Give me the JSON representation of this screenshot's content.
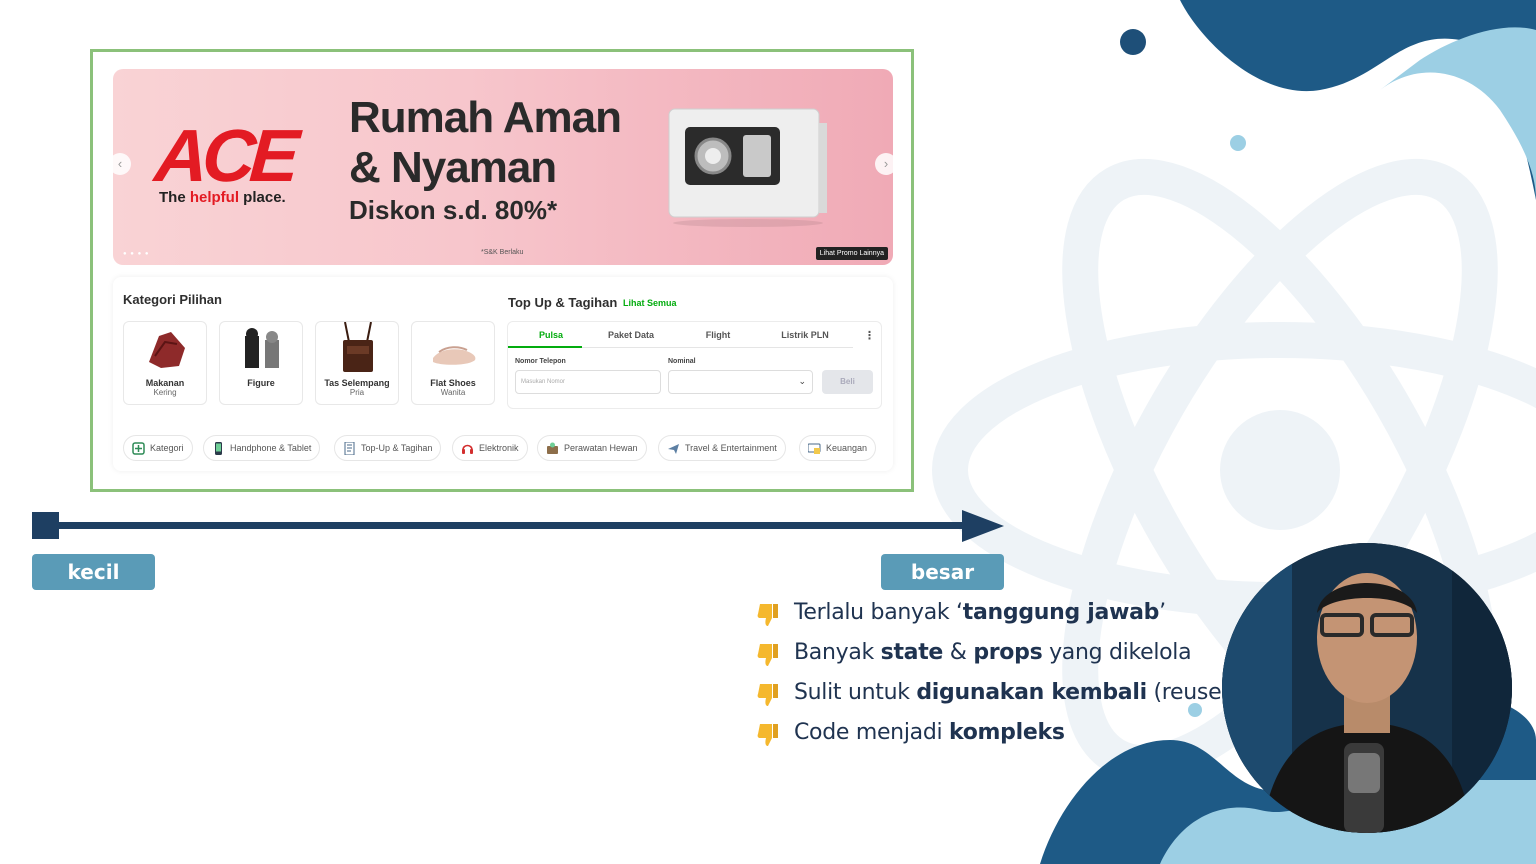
{
  "banner": {
    "brand": "ACE",
    "tagline_pre": "The ",
    "tagline_accent": "helpful",
    "tagline_post": " place.",
    "title_line1": "Rumah Aman",
    "title_line2": "& Nyaman",
    "subtitle": "Diskon s.d. 80%*",
    "note": "*S&K Berlaku",
    "promo_button": "Lihat Promo Lainnya",
    "prev_arrow": "‹",
    "next_arrow": "›"
  },
  "kategori": {
    "title": "Kategori Pilihan",
    "cards": [
      {
        "name": "Makanan",
        "sub": "Kering",
        "icon": "dried-food-icon"
      },
      {
        "name": "Figure",
        "sub": "",
        "icon": "figure-toy-icon"
      },
      {
        "name": "Tas Selempang",
        "sub": "Pria",
        "icon": "sling-bag-icon"
      },
      {
        "name": "Flat Shoes",
        "sub": "Wanita",
        "icon": "flat-shoe-icon"
      }
    ]
  },
  "topup": {
    "title": "Top Up & Tagihan",
    "link": "Lihat Semua",
    "tabs": [
      "Pulsa",
      "Paket Data",
      "Flight",
      "Listrik PLN"
    ],
    "active_tab": "Pulsa",
    "more": "⋮",
    "phone_label": "Nomor Telepon",
    "phone_placeholder": "Masukan Nomor",
    "nominal_label": "Nominal",
    "nominal_value": "",
    "buy_label": "Beli"
  },
  "chips": [
    {
      "label": "Kategori",
      "icon": "category-icon"
    },
    {
      "label": "Handphone & Tablet",
      "icon": "phone-icon"
    },
    {
      "label": "Top-Up & Tagihan",
      "icon": "bill-icon"
    },
    {
      "label": "Elektronik",
      "icon": "headphones-icon"
    },
    {
      "label": "Perawatan Hewan",
      "icon": "pet-care-icon"
    },
    {
      "label": "Travel & Entertainment",
      "icon": "plane-icon"
    },
    {
      "label": "Keuangan",
      "icon": "finance-icon"
    }
  ],
  "scale": {
    "small": "kecil",
    "large": "besar"
  },
  "colors": {
    "frame": "#8bc17a",
    "axis": "#1e3f62",
    "pill": "#5a9bb7",
    "accent": "#03ac0e",
    "ace_red": "#e31b23"
  },
  "bullets": [
    {
      "icon": "thumbs-down-icon",
      "parts": [
        "Terlalu banyak ‘",
        "tanggung jawab",
        "’",
        "",
        ""
      ]
    },
    {
      "icon": "thumbs-down-icon",
      "parts": [
        "Banyak ",
        "state",
        " & ",
        "props",
        " yang dikelola"
      ]
    },
    {
      "icon": "thumbs-down-icon",
      "parts": [
        "Sulit untuk ",
        "digunakan kembali",
        " (reuse)",
        "",
        ""
      ]
    },
    {
      "icon": "thumbs-down-icon",
      "parts": [
        "Code menjadi ",
        "kompleks",
        "",
        "",
        ""
      ]
    }
  ]
}
